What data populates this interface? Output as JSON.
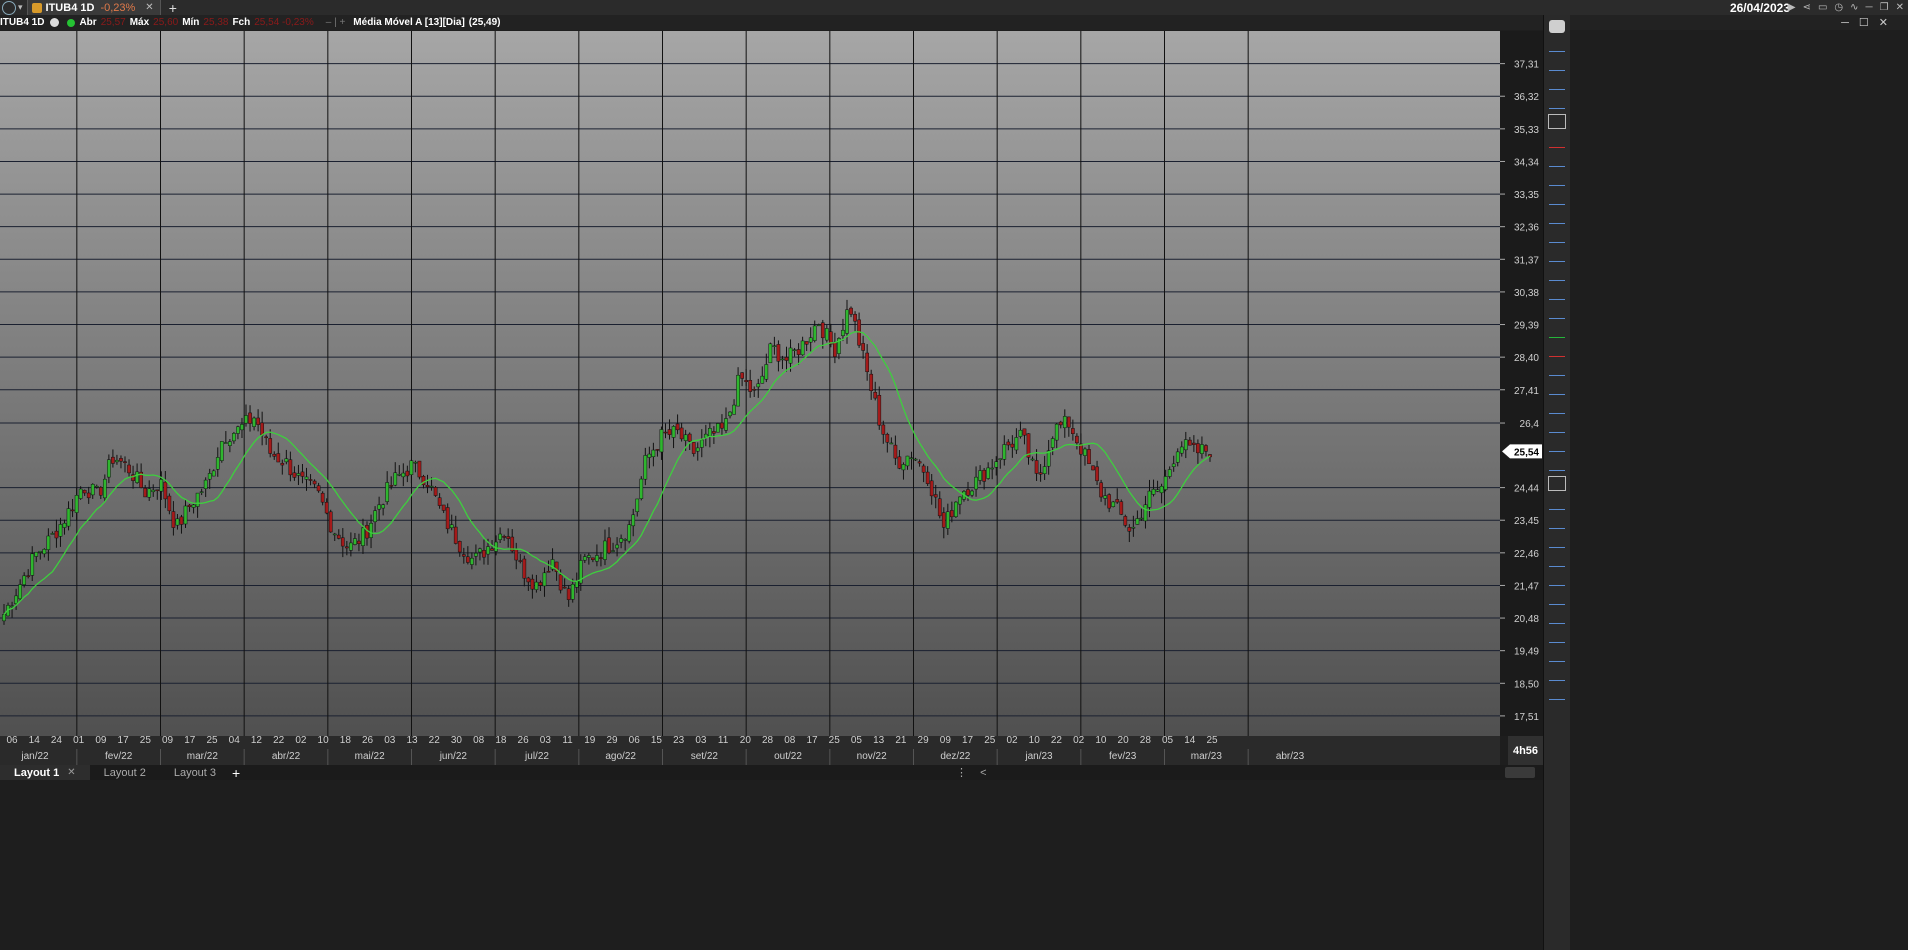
{
  "topbar": {
    "tab_name": "ITUB4 1D",
    "tab_change": "-0,23%",
    "tab_close": "✕",
    "add_tab": "+",
    "date": "26/04/2023"
  },
  "infobar": {
    "symbol": "ITUB4 1D",
    "badge": "M",
    "open_label": "Abr",
    "open_value": "25,57",
    "high_label": "Máx",
    "high_value": "25,60",
    "low_label": "Mín",
    "low_value": "25,38",
    "close_label": "Fch",
    "close_value": "25,54 -0,23%",
    "indicator_label": "Média Móvel A [13][Dia]",
    "indicator_value": "(25,49)"
  },
  "timeframe": "4h56",
  "layouts": [
    "Layout 1",
    "Layout 2",
    "Layout 3"
  ],
  "add_layout": "+",
  "colors": {
    "up": "#2fb62f",
    "down": "#a41a1a",
    "ma": "#3ecf3e",
    "grid": "#000000"
  },
  "chart_data": {
    "type": "candlestick",
    "price_ticks": [
      "37,31",
      "36,32",
      "35,33",
      "34,34",
      "33,35",
      "32,36",
      "31,37",
      "30,38",
      "29,39",
      "28,40",
      "27,41",
      "26,4",
      "24,44",
      "23,45",
      "22,46",
      "21,47",
      "20,48",
      "19,49",
      "18,50",
      "17,51"
    ],
    "price_range": [
      16.9,
      38.3
    ],
    "last_price": "25,54",
    "day_ticks": [
      "06",
      "14",
      "24",
      "01",
      "09",
      "17",
      "25",
      "09",
      "17",
      "25",
      "04",
      "12",
      "22",
      "02",
      "10",
      "18",
      "26",
      "03",
      "13",
      "22",
      "30",
      "08",
      "18",
      "26",
      "03",
      "11",
      "19",
      "29",
      "06",
      "15",
      "23",
      "03",
      "11",
      "20",
      "28",
      "08",
      "17",
      "25",
      "05",
      "13",
      "21",
      "29",
      "09",
      "17",
      "25",
      "02",
      "10",
      "22",
      "02",
      "10",
      "20",
      "28",
      "05",
      "14",
      "25"
    ],
    "month_ticks": [
      "jan/22",
      "fev/22",
      "mar/22",
      "abr/22",
      "mai/22",
      "jun/22",
      "jul/22",
      "ago/22",
      "set/22",
      "out/22",
      "nov/22",
      "dez/22",
      "jan/23",
      "fev/23",
      "mar/23",
      "abr/23"
    ],
    "ma_period": 13,
    "close_path": [
      20.6,
      21.5,
      22.4,
      22.9,
      23.6,
      24.5,
      24.2,
      25.4,
      25.0,
      24.3,
      24.6,
      23.2,
      24.0,
      24.6,
      26.0,
      26.2,
      26.6,
      25.5,
      25.2,
      24.6,
      24.3,
      23.2,
      22.6,
      23.0,
      24.0,
      24.7,
      25.1,
      24.7,
      23.6,
      22.8,
      22.2,
      22.7,
      23.2,
      22.0,
      21.5,
      22.3,
      21.0,
      22.2,
      22.5,
      22.8,
      23.3,
      25.3,
      26.0,
      26.1,
      25.5,
      26.0,
      26.2,
      27.8,
      27.2,
      28.7,
      28.3,
      28.8,
      29.5,
      28.6,
      30.0,
      28.1,
      26.3,
      25.2,
      25.5,
      24.8,
      23.2,
      24.3,
      24.6,
      25.1,
      25.7,
      26.0,
      24.6,
      26.2,
      26.4,
      25.4,
      24.3,
      23.8,
      23.1,
      24.1,
      24.5,
      25.8,
      25.5,
      25.6
    ]
  }
}
